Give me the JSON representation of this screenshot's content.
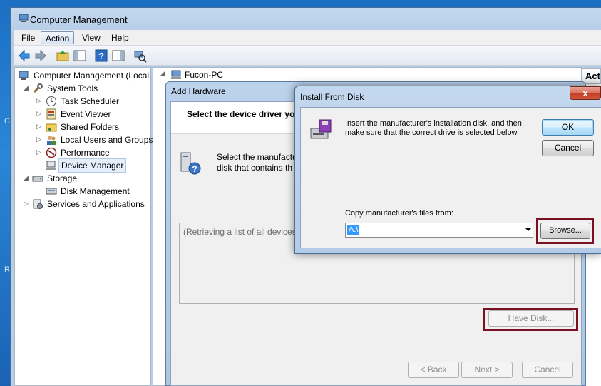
{
  "main_window": {
    "title": "Computer Management",
    "menu": [
      "File",
      "Action",
      "View",
      "Help"
    ]
  },
  "tree": {
    "root": "Computer Management (Local",
    "system_tools": "System Tools",
    "task_scheduler": "Task Scheduler",
    "event_viewer": "Event Viewer",
    "shared_folders": "Shared Folders",
    "local_users": "Local Users and Groups",
    "performance": "Performance",
    "device_manager": "Device Manager",
    "storage": "Storage",
    "disk_management": "Disk Management",
    "services": "Services and Applications"
  },
  "right_pane": {
    "node": "Fucon-PC",
    "actions_header": "Acti"
  },
  "add_hardware": {
    "title": "Add Hardware",
    "heading": "Select the device driver yo",
    "desc_line1": "Select the manufactu",
    "desc_line2": "disk that contains th",
    "list_text": "(Retrieving a list of all devices",
    "have_disk": "Have Disk...",
    "back": "< Back",
    "next": "Next >",
    "cancel": "Cancel"
  },
  "install_from_disk": {
    "title": "Install From Disk",
    "close": "x",
    "message": "Insert the manufacturer's installation disk, and then make sure that the correct drive is selected below.",
    "ok": "OK",
    "cancel": "Cancel",
    "copy_label": "Copy manufacturer's files from:",
    "path_value": "A:\\",
    "browse": "Browse..."
  },
  "desktop": {
    "edge_glyph_1": "C",
    "edge_glyph_2": "R"
  },
  "colors": {
    "highlight_box": "#7a1021",
    "desktop": "#2a86d6"
  }
}
